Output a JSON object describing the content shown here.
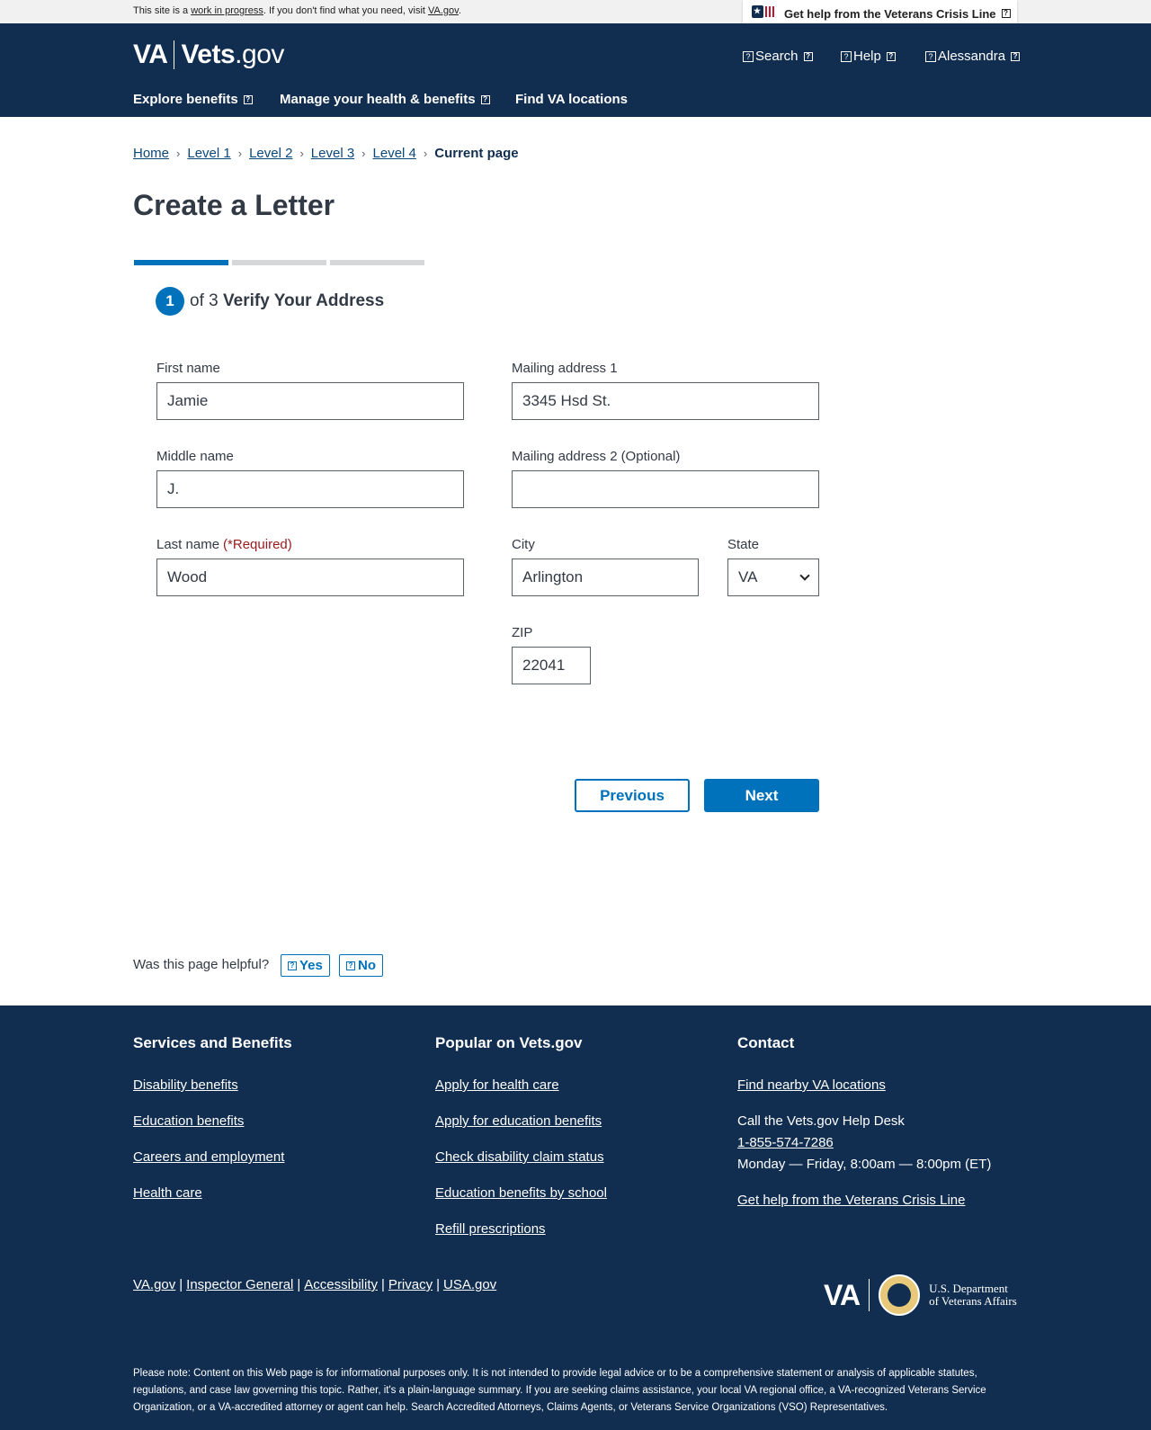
{
  "banner": {
    "prefix": "This site is a",
    "link": "work in progress",
    "middle": ". If you don't find what you need, visit",
    "vagov": "VA.gov",
    "end": "."
  },
  "crisis_line": {
    "label": "Get help from the Veterans Crisis Line"
  },
  "logo": {
    "va": "VA",
    "vets": "Vets",
    "gov": ".gov"
  },
  "utility": {
    "search": "Search",
    "help": "Help",
    "user": "Alessandra"
  },
  "nav": {
    "explore": "Explore benefits",
    "manage": "Manage your health & benefits",
    "find": "Find VA locations"
  },
  "breadcrumb": [
    {
      "label": "Home"
    },
    {
      "label": "Level 1"
    },
    {
      "label": "Level 2"
    },
    {
      "label": "Level 3"
    },
    {
      "label": "Level 4"
    },
    {
      "label": "Current page"
    }
  ],
  "page_title": "Create a Letter",
  "progress": {
    "current_step": 1,
    "total_steps": 3
  },
  "step": {
    "number": "1",
    "of": "of 3",
    "title": "Verify Your Address"
  },
  "form": {
    "first_name": {
      "label": "First name",
      "value": "Jamie"
    },
    "middle_name": {
      "label": "Middle name",
      "value": "J."
    },
    "last_name": {
      "label": "Last name",
      "required": "(*Required)",
      "value": "Wood"
    },
    "mailing1": {
      "label": "Mailing address 1",
      "value": "3345 Hsd St."
    },
    "mailing2": {
      "label": "Mailing address 2",
      "optional": "(Optional)",
      "value": ""
    },
    "city": {
      "label": "City",
      "value": "Arlington"
    },
    "state": {
      "label": "State",
      "value": "VA"
    },
    "zip": {
      "label": "ZIP",
      "value": "22041"
    }
  },
  "buttons": {
    "previous": "Previous",
    "next": "Next"
  },
  "feedback": {
    "question": "Was this page helpful?",
    "yes": "Yes",
    "no": "No"
  },
  "footer": {
    "services": {
      "heading": "Services and Benefits",
      "links": [
        "Disability benefits",
        "Education benefits",
        "Careers and employment",
        "Health care"
      ]
    },
    "popular": {
      "heading": "Popular on Vets.gov",
      "links": [
        "Apply for health care",
        "Apply for education benefits",
        "Check disability claim status",
        "Education benefits by school",
        "Refill prescriptions"
      ]
    },
    "contact": {
      "heading": "Contact",
      "find": "Find nearby VA locations",
      "call": "Call the Vets.gov Help Desk",
      "phone": "1-855-574-7286",
      "hours": "Monday — Friday, 8:00am — 8:00pm (ET)",
      "crisis": "Get help from the Veterans Crisis Line"
    },
    "legal": [
      "VA.gov",
      "Inspector General",
      "Accessibility",
      "Privacy",
      "USA.gov"
    ],
    "separator": "|",
    "logo": {
      "va": "VA",
      "dept_line1": "U.S. Department",
      "dept_line2": "of Veterans Affairs"
    },
    "disclaimer": "Please note: Content on this Web page is for informational purposes only. It is not intended to provide legal advice or to be a comprehensive statement or analysis of applicable statutes, regulations, and case law governing this topic. Rather, it's a plain-language summary. If you are seeking claims assistance, your local VA regional office, a VA-recognized Veterans Service Organization, or a VA-accredited attorney or agent can help. Search Accredited Attorneys, Claims Agents, or Veterans Service Organizations (VSO) Representatives."
  },
  "colors": {
    "primary": "#0071bb",
    "navy": "#112e51",
    "required": "#981b1e"
  }
}
